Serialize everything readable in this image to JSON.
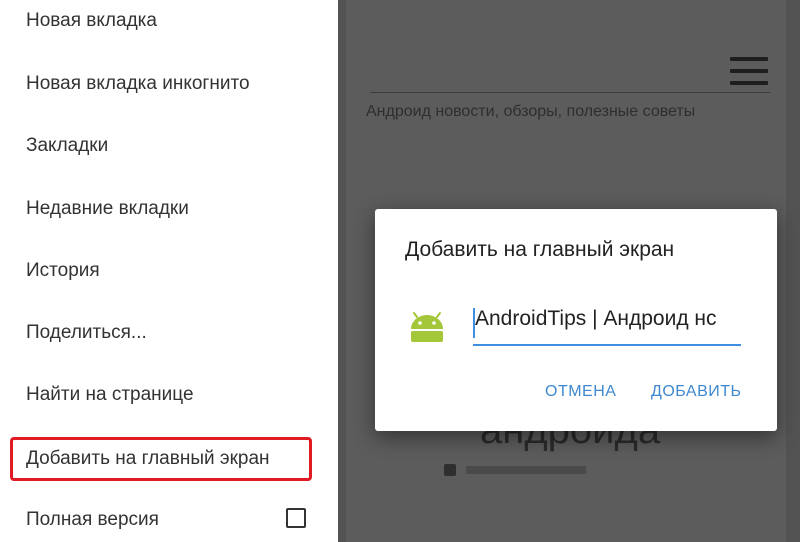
{
  "menu": {
    "items": [
      {
        "label": "Новая вкладка"
      },
      {
        "label": "Новая вкладка инкогнито"
      },
      {
        "label": "Закладки"
      },
      {
        "label": "Недавние вкладки"
      },
      {
        "label": "История"
      },
      {
        "label": "Поделиться..."
      },
      {
        "label": "Найти на странице"
      },
      {
        "label": "Добавить на главный экран"
      },
      {
        "label": "Полная версия"
      }
    ],
    "highlighted_item": "Добавить на главный экран",
    "highlight_color": "#e01b24",
    "desktop_version_checked": false
  },
  "page": {
    "tagline": "Андроид новости, обзоры, полезные советы",
    "heading_fragment": "андроида"
  },
  "dialog": {
    "title": "Добавить на главный экран",
    "icon": "android-icon",
    "name_value": "AndroidTips | Андроид нс",
    "cancel_label": "ОТМЕНА",
    "add_label": "ДОБАВИТЬ",
    "accent_color": "#3f88cf"
  }
}
